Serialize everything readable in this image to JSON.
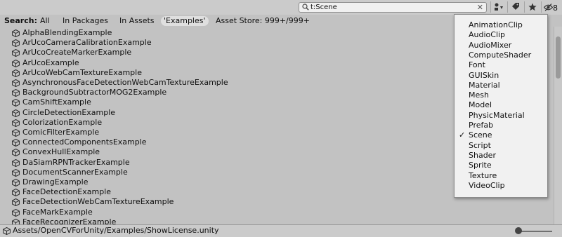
{
  "toolbar": {
    "search_value": "t:Scene",
    "clear_glyph": "✕",
    "hidden_count": "8"
  },
  "filterbar": {
    "label": "Search:",
    "all": "All",
    "in_packages": "In Packages",
    "in_assets": "In Assets",
    "examples": "'Examples'",
    "asset_store": "Asset Store: 999+/999+"
  },
  "items": [
    {
      "name": "AlphaBlendingExample"
    },
    {
      "name": "ArUcoCameraCalibrationExample"
    },
    {
      "name": "ArUcoCreateMarkerExample"
    },
    {
      "name": "ArUcoExample"
    },
    {
      "name": "ArUcoWebCamTextureExample"
    },
    {
      "name": "AsynchronousFaceDetectionWebCamTextureExample"
    },
    {
      "name": "BackgroundSubtractorMOG2Example"
    },
    {
      "name": "CamShiftExample"
    },
    {
      "name": "CircleDetectionExample"
    },
    {
      "name": "ColorizationExample"
    },
    {
      "name": "ComicFilterExample"
    },
    {
      "name": "ConnectedComponentsExample"
    },
    {
      "name": "ConvexHullExample"
    },
    {
      "name": "DaSiamRPNTrackerExample"
    },
    {
      "name": "DocumentScannerExample"
    },
    {
      "name": "DrawingExample"
    },
    {
      "name": "FaceDetectionExample"
    },
    {
      "name": "FaceDetectionWebCamTextureExample"
    },
    {
      "name": "FaceMarkExample"
    },
    {
      "name": "FaceRecognizerExample"
    }
  ],
  "type_menu": [
    {
      "label": "AnimationClip",
      "checked": false
    },
    {
      "label": "AudioClip",
      "checked": false
    },
    {
      "label": "AudioMixer",
      "checked": false
    },
    {
      "label": "ComputeShader",
      "checked": false
    },
    {
      "label": "Font",
      "checked": false
    },
    {
      "label": "GUISkin",
      "checked": false
    },
    {
      "label": "Material",
      "checked": false
    },
    {
      "label": "Mesh",
      "checked": false
    },
    {
      "label": "Model",
      "checked": false
    },
    {
      "label": "PhysicMaterial",
      "checked": false
    },
    {
      "label": "Prefab",
      "checked": false
    },
    {
      "label": "Scene",
      "checked": true
    },
    {
      "label": "Script",
      "checked": false
    },
    {
      "label": "Shader",
      "checked": false
    },
    {
      "label": "Sprite",
      "checked": false
    },
    {
      "label": "Texture",
      "checked": false
    },
    {
      "label": "VideoClip",
      "checked": false
    }
  ],
  "check_glyph": "✓",
  "status": {
    "path": "Assets/OpenCVForUnity/Examples/ShowLicense.unity"
  },
  "icons": {
    "search": "search-icon",
    "scene_asset": "unity-scene-icon",
    "filter_by_type": "filter-by-type-icon",
    "filter_by_label": "label-tag-icon",
    "favorite": "star-icon",
    "hidden_packages": "eye-slash-icon"
  }
}
